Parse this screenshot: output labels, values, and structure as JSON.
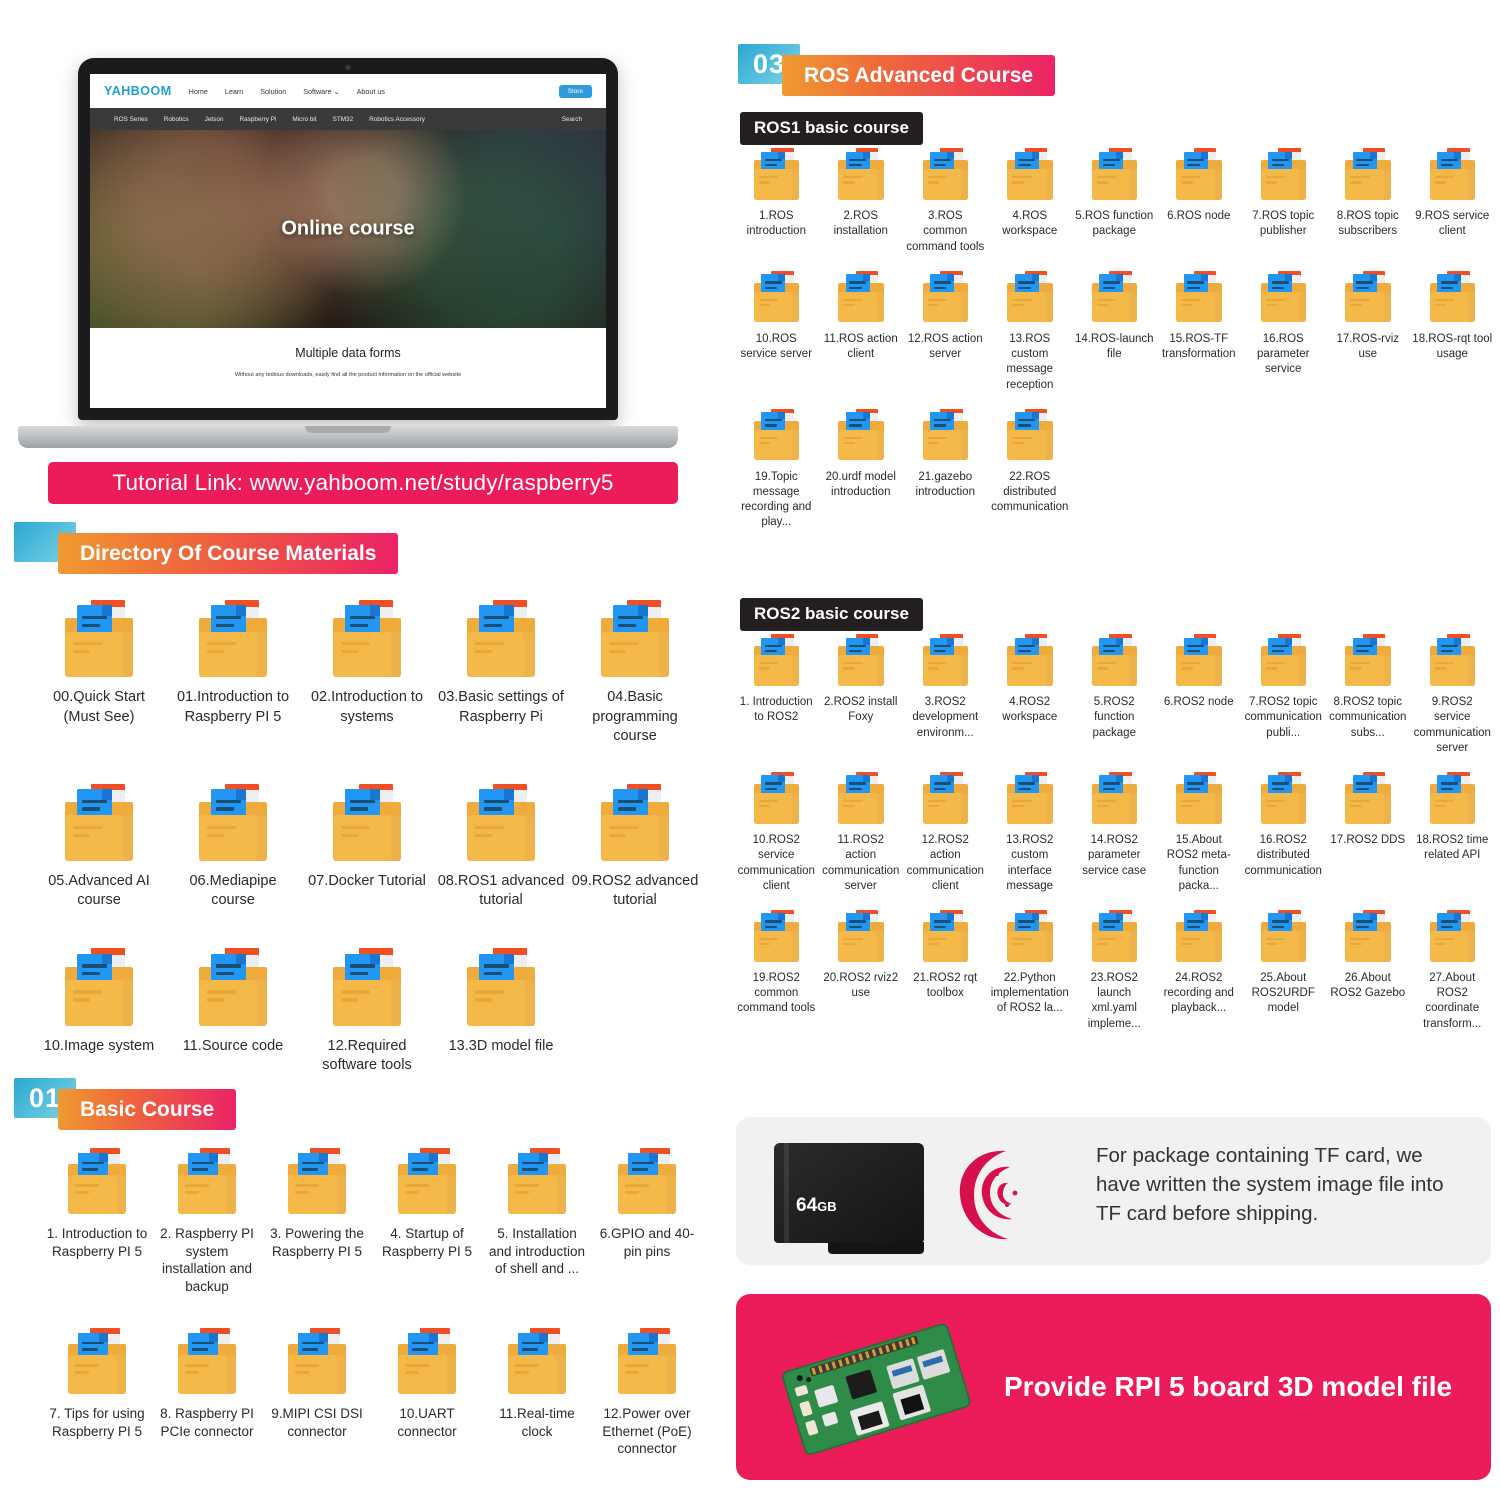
{
  "laptop": {
    "brand": "YAHBOOM",
    "nav_primary": [
      "Home",
      "Learn",
      "Solution",
      "Software ⌄",
      "About us"
    ],
    "store_button": "Store",
    "nav_secondary": [
      "ROS Series",
      "Robotics",
      "Jetson",
      "Raspberry Pi",
      "Micro bit",
      "STM32",
      "Robotics Accessory"
    ],
    "search_label": "Search",
    "hero_title": "Online course",
    "footer_title": "Multiple data forms",
    "footer_sub": "Without any tedious downloads, easily find all the product information on the official website"
  },
  "tutorial_link": "Tutorial Link: www.yahboom.net/study/raspberry5",
  "sections": {
    "directory": {
      "number": "",
      "title": "Directory Of Course Materials",
      "items": [
        "00.Quick Start (Must See)",
        "01.Introduction to Raspberry PI 5",
        "02.Introduction to systems",
        "03.Basic settings of Raspberry Pi",
        "04.Basic programming course",
        "05.Advanced AI course",
        "06.Mediapipe course",
        "07.Docker Tutorial",
        "08.ROS1 advanced tutorial",
        "09.ROS2 advanced tutorial",
        "10.Image system",
        "11.Source code",
        "12.Required software tools",
        "13.3D model file"
      ]
    },
    "basic_course": {
      "number": "01",
      "title": "Basic Course",
      "items": [
        "1. Introduction to Raspberry PI 5",
        "2. Raspberry PI system installation and backup",
        "3. Powering the Raspberry PI 5",
        "4. Startup of Raspberry PI 5",
        "5. Installation and introduction of shell and ...",
        "6.GPIO and 40-pin pins",
        "7. Tips for using Raspberry PI 5",
        "8. Raspberry PI PCIe connector",
        "9.MIPI CSI DSI connector",
        "10.UART connector",
        "11.Real-time clock",
        "12.Power over Ethernet (PoE) connector"
      ]
    },
    "ros_advanced": {
      "number": "03",
      "title": "ROS Advanced Course",
      "ros1": {
        "label": "ROS1 basic course",
        "items": [
          "1.ROS introduction",
          "2.ROS installation",
          "3.ROS common command tools",
          "4.ROS workspace",
          "5.ROS function package",
          "6.ROS node",
          "7.ROS topic publisher",
          "8.ROS topic subscribers",
          "9.ROS service client",
          "10.ROS service server",
          "11.ROS action client",
          "12.ROS action server",
          "13.ROS custom message reception",
          "14.ROS-launch file",
          "15.ROS-TF transformation",
          "16.ROS parameter service",
          "17.ROS-rviz use",
          "18.ROS-rqt tool usage",
          "19.Topic message recording and play...",
          "20.urdf model introduction",
          "21.gazebo introduction",
          "22.ROS distributed communication"
        ]
      },
      "ros2": {
        "label": "ROS2 basic course",
        "items": [
          "1. Introduction to ROS2",
          "2.ROS2 install Foxy",
          "3.ROS2 development environm...",
          "4.ROS2 workspace",
          "5.ROS2 function package",
          "6.ROS2 node",
          "7.ROS2 topic communication publi...",
          "8.ROS2 topic communication subs...",
          "9.ROS2 service communication server",
          "10.ROS2 service communication client",
          "11.ROS2 action communication server",
          "12.ROS2 action communication client",
          "13.ROS2 custom interface message",
          "14.ROS2 parameter service case",
          "15.About ROS2 meta-function packa...",
          "16.ROS2 distributed communication",
          "17.ROS2 DDS",
          "18.ROS2 time related API",
          "19.ROS2 common command tools",
          "20.ROS2 rviz2 use",
          "21.ROS2 rqt toolbox",
          "22.Python implementation of ROS2 la...",
          "23.ROS2 launch xml.yaml impleme...",
          "24.ROS2 recording and playback...",
          "25.About ROS2URDF model",
          "26.About ROS2 Gazebo",
          "27.About ROS2 coordinate transform..."
        ]
      }
    }
  },
  "tf_panel": {
    "card_size": "64",
    "card_size_unit": "GB",
    "text": "For package containing TF card, we have written the system image file into TF card before shipping."
  },
  "rpi_panel": {
    "text": "Provide RPI 5 board 3D model file"
  },
  "colors": {
    "pink": "#ec1b5a",
    "orange": "#ef9a32",
    "cyan": "#2aa8d4",
    "black_badge": "#231f20",
    "folder_yellow": "#f5b949",
    "folder_blue": "#2196f3",
    "folder_red": "#f04e23"
  }
}
